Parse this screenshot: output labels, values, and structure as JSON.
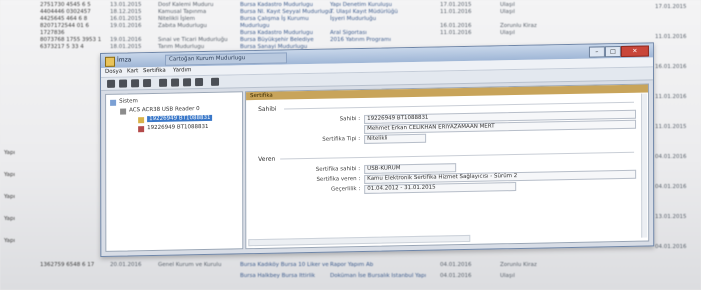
{
  "background_sheet": {
    "rows": [
      {
        "c1": "2751730 4545 6 5",
        "c2": "13.01.2015",
        "c3": "Dosf Kalemi Muduru",
        "c4": "Bursa Kadastro Mudurlugu",
        "c5": "Yapı Denetim Kuruluşu",
        "c6": "17.01.2015",
        "c7": "Ulaşıl"
      },
      {
        "c1": "4404446 0302457",
        "c2": "18.12.2015",
        "c3": "Kamusal Tapınma",
        "c4": "Bursa Nl. Kayıt Seyyal Mudurlugu",
        "c5": "T. Ulaşıl Kayıt Müdürlüğü",
        "c6": "11.01.2016",
        "c7": "Ulaşıl"
      },
      {
        "c1": "4425645 464 6 8",
        "c2": "16.01.2015",
        "c3": "Nitelikli İşlem",
        "c4": "Bursa Çalışma İş Kurumu",
        "c5": "İşyeri Mudurluğu",
        "c6": "",
        "c7": ""
      },
      {
        "c1": "8207172544 01 6",
        "c2": "19.01.2016",
        "c3": "Zabıta Mudurlugu",
        "c4": "Mudurlugu",
        "c5": "",
        "c6": "16.01.2016",
        "c7": "Zorunlu Kiraz"
      },
      {
        "c1": "1727836",
        "c2": "",
        "c3": "",
        "c4": "Bursa Kadastro Mudurlugu",
        "c5": "Aral Sigortası",
        "c6": "11.01.2016",
        "c7": "Ulaşıl"
      },
      {
        "c1": "8073768 1755 3953 1",
        "c2": "19.01.2016",
        "c3": "Sınai ve Ticari Mudurluğu",
        "c4": "Bursa Büyükşehir Belediye",
        "c5": "2016 Yatırım Programı",
        "c6": "",
        "c7": ""
      },
      {
        "c1": "6373217 5 33 4",
        "c2": "18.01.2015",
        "c3": "Tarım Mudurlugu",
        "c4": "Bursa Sanayi Mudurlugu",
        "c5": "",
        "c6": "",
        "c7": ""
      }
    ],
    "lower_rows": [
      {
        "c1": "1362759 6548 6 17",
        "c2": "20.01.2016",
        "c3": "Genel Kurum ve Kurulu",
        "c4": "Bursa Kadıköy Bursa 10 Liker ve",
        "c5": "Rapor Yapım Ab",
        "c6": "04.01.2016",
        "c7": "Zorunlu Kiraz"
      },
      {
        "c1": "",
        "c2": "",
        "c3": "",
        "c4": "Bursa Halkbey Bursa Ittirlik",
        "c5": "Doküman İse Bursalık Istanbul Yapı",
        "c6": "04.01.2016",
        "c7": "Ulaşıl"
      }
    ],
    "left_column": [
      "Yapı",
      "Yapı",
      "Yapı",
      "Yapı",
      "Yapı"
    ],
    "right_column": [
      "17.01.2015",
      "11.01.2016",
      "16.01.2016",
      "11.01.2016",
      "11.01.2015",
      "04.01.2016",
      "04.01.2016",
      "13.01.2015",
      "04.01.2016"
    ]
  },
  "window": {
    "title": "İmza",
    "title_path": "Cartoğan Kurum Mudurlugu",
    "menu": [
      "Dosya",
      "Kart",
      "Sertifika",
      "Yardım"
    ],
    "buttons": {
      "minimize": "–",
      "maximize": "□",
      "close": "✕"
    }
  },
  "tree": {
    "root_label": "Sistem",
    "reader_label": "ACS ACR38 USB Reader 0",
    "cert_selected": "19226949 BT1088831",
    "cert_second": "19226949 BT1088831"
  },
  "panel": {
    "header": "Sertifika",
    "group_owner": "Sahibi",
    "fields_owner": [
      {
        "label": "Sahibi :",
        "value": "19226949 BT1088831"
      },
      {
        "label": "",
        "value": "Mehmet Erkan CELIKHAN ERIYAZAMAAN MERT"
      },
      {
        "label": "Sertifika Tipi :",
        "value": "Nitelikli"
      }
    ],
    "group_issuer": "Veren",
    "fields_issuer": [
      {
        "label": "Sertifika sahibi :",
        "value": "USB-KURUM"
      },
      {
        "label": "Sertifika veren :",
        "value": "Kamu Elektronik Sertifika Hizmet Sağlayıcısı - Sürüm 2"
      },
      {
        "label": "Geçerlilik :",
        "value": "01.04.2012 - 31.01.2015"
      }
    ]
  }
}
